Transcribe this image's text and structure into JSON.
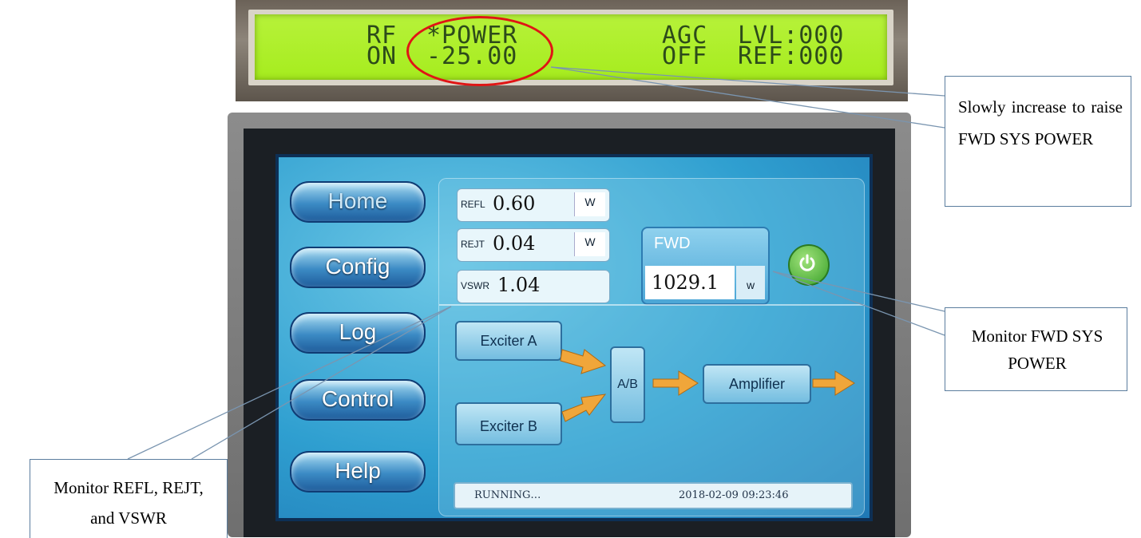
{
  "lcd": {
    "rf_label": "RF",
    "rf_state": "ON",
    "power_label": "*POWER",
    "power_value": "-25.00",
    "agc_label": "AGC",
    "agc_state": "OFF",
    "lvl": "LVL:000",
    "ref": "REF:000"
  },
  "nav": {
    "home": "Home",
    "config": "Config",
    "log": "Log",
    "control": "Control",
    "help": "Help"
  },
  "readouts": {
    "refl_label": "REFL",
    "refl_value": "0.60",
    "refl_unit": "W",
    "rejt_label": "REJT",
    "rejt_value": "0.04",
    "rejt_unit": "W",
    "vswr_label": "VSWR",
    "vswr_value": "1.04"
  },
  "fwd": {
    "title": "FWD",
    "value": "1029.1",
    "unit": "w"
  },
  "diagram": {
    "exciter_a": "Exciter A",
    "exciter_b": "Exciter B",
    "ab": "A/B",
    "amplifier": "Amplifier"
  },
  "status": {
    "state": "RUNNING…",
    "datetime": "2018-02-09 09:23:46"
  },
  "callouts": {
    "power": "Slowly increase to raise FWD SYS POWER",
    "fwd": "Monitor FWD SYS POWER",
    "refl": "Monitor REFL, REJT, and VSWR"
  },
  "colors": {
    "lcd_green": "#a6ec1e",
    "highlight_red": "#e01515",
    "screen_blue": "#2f9fd0",
    "power_green": "#3aa12a",
    "arrow_orange": "#f0a63a"
  }
}
